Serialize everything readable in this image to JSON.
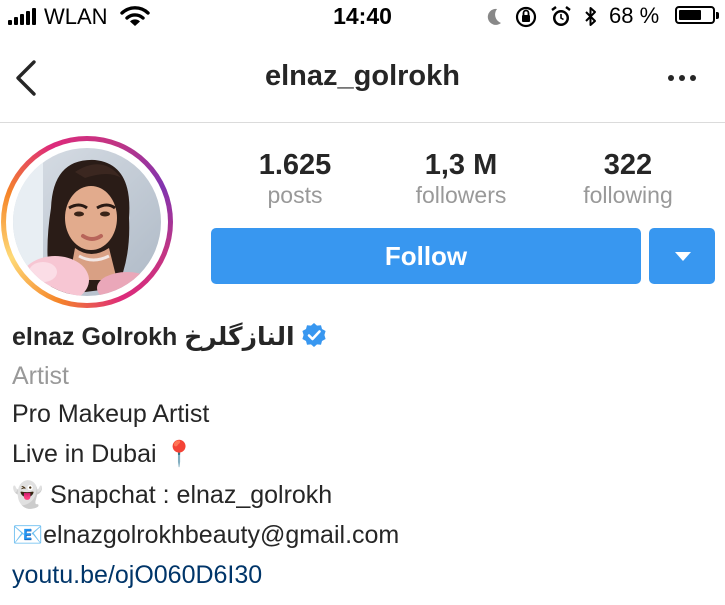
{
  "status_bar": {
    "carrier": "WLAN",
    "time": "14:40",
    "battery_percent": "68 %",
    "battery_level": 0.68,
    "icons": [
      "signal-icon",
      "wifi-icon",
      "moon-icon",
      "orientation-lock-icon",
      "alarm-icon",
      "bluetooth-icon",
      "battery-icon"
    ]
  },
  "nav": {
    "title": "elnaz_golrokh",
    "back_icon": "chevron-left-icon",
    "more_icon": "more-horizontal-icon"
  },
  "stats": [
    {
      "value": "1.625",
      "label": "posts"
    },
    {
      "value": "1,3 M",
      "label": "followers"
    },
    {
      "value": "322",
      "label": "following"
    }
  ],
  "actions": {
    "follow_label": "Follow",
    "dropdown_icon": "caret-down-icon",
    "button_color": "#3897f0"
  },
  "profile": {
    "display_name": "elnaz Golrokh النازگلرخ",
    "verified_icon": "verified-badge-icon",
    "category": "Artist",
    "bio_lines": [
      "Pro Makeup Artist",
      "Live in Dubai 📍",
      "👻 Snapchat : elnaz_golrokh",
      "📧elnazgolrokhbeauty@gmail.com"
    ],
    "link": "youtu.be/ojO060D6I30"
  }
}
